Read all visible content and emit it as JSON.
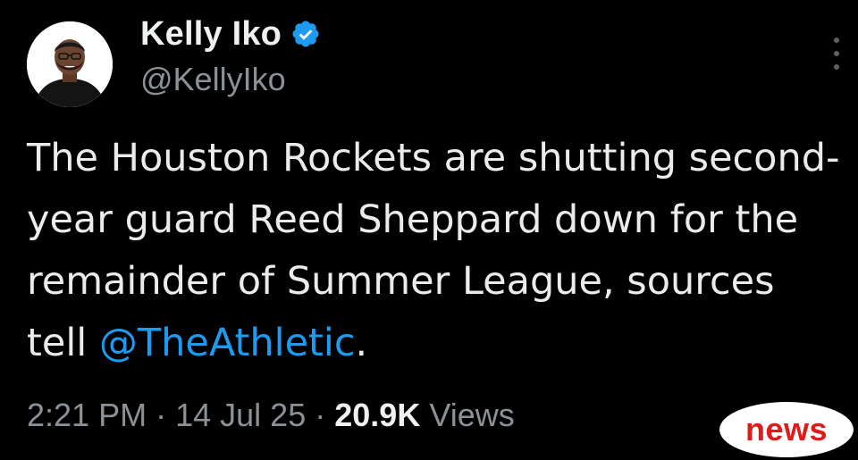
{
  "tweet": {
    "display_name": "Kelly Iko",
    "handle": "@KellyIko",
    "verified": true,
    "text_before_mention": "The Houston Rockets are shutting second-year guard Reed Sheppard down for the remainder of Summer League, sources tell ",
    "mention": "@TheAthletic",
    "text_after_mention": ".",
    "time": "2:21 PM",
    "separator": "·",
    "date": "14 Jul 25",
    "views_count": "20.9K",
    "views_label": "Views"
  },
  "watermark": {
    "label": "news"
  },
  "colors": {
    "background": "#000000",
    "text": "#e7e9ea",
    "secondary": "#8b9196",
    "mention": "#1d9bf0",
    "verified": "#1d9bf0",
    "badge_text": "#e01b1b"
  },
  "icons": {
    "verified": "verified-badge-icon",
    "more": "more-options-icon"
  }
}
